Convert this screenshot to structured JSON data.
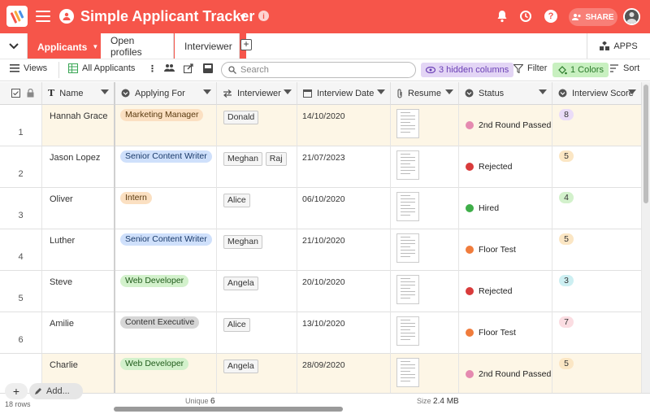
{
  "header": {
    "title": "Simple Applicant Tracker",
    "share_label": "SHARE"
  },
  "tabs": [
    {
      "label": "Applicants",
      "active": true
    },
    {
      "label": "Open profiles",
      "active": false
    },
    {
      "label": "Interviewer",
      "active": false
    }
  ],
  "apps_label": "APPS",
  "toolbar": {
    "views_label": "Views",
    "view_name": "All Applicants",
    "search_placeholder": "Search",
    "hidden_columns_label": "3 hidden columns",
    "filter_label": "Filter",
    "colors_label": "1 Colors",
    "sort_label": "Sort"
  },
  "columns": [
    "Name",
    "Applying For",
    "Interviewer",
    "Interview Date",
    "Resume",
    "Status",
    "Interview Score"
  ],
  "rows": [
    {
      "num": "1",
      "name": "Hannah Grace",
      "applying_for": "Marketing Manager",
      "applying_color": "orange",
      "interviewers": [
        "Donald"
      ],
      "date": "14/10/2020",
      "status": "2nd Round Passed",
      "status_color": "#e58ab0",
      "score": "8",
      "score_bg": "#eadcf8",
      "highlight": true
    },
    {
      "num": "2",
      "name": "Jason Lopez",
      "applying_for": "Senior Content Writer",
      "applying_color": "blue",
      "interviewers": [
        "Meghan",
        "Raj"
      ],
      "date": "21/07/2023",
      "status": "Rejected",
      "status_color": "#d93b3b",
      "score": "5",
      "score_bg": "#fbe6c4",
      "highlight": false
    },
    {
      "num": "3",
      "name": "Oliver",
      "applying_for": "Intern",
      "applying_color": "orange",
      "interviewers": [
        "Alice"
      ],
      "date": "06/10/2020",
      "status": "Hired",
      "status_color": "#3fae49",
      "score": "4",
      "score_bg": "#d3f1cc",
      "highlight": false
    },
    {
      "num": "4",
      "name": "Luther",
      "applying_for": "Senior Content Writer",
      "applying_color": "blue",
      "interviewers": [
        "Meghan"
      ],
      "date": "21/10/2020",
      "status": "Floor Test",
      "status_color": "#f07c3c",
      "score": "5",
      "score_bg": "#fbe6c4",
      "highlight": false
    },
    {
      "num": "5",
      "name": "Steve",
      "applying_for": "Web Developer",
      "applying_color": "green",
      "interviewers": [
        "Angela"
      ],
      "date": "20/10/2020",
      "status": "Rejected",
      "status_color": "#d93b3b",
      "score": "3",
      "score_bg": "#cdeff2",
      "highlight": false
    },
    {
      "num": "6",
      "name": "Amilie",
      "applying_for": "Content Executive",
      "applying_color": "gray",
      "interviewers": [
        "Alice"
      ],
      "date": "13/10/2020",
      "status": "Floor Test",
      "status_color": "#f07c3c",
      "score": "7",
      "score_bg": "#fbdde2",
      "highlight": false
    },
    {
      "num": "",
      "name": "Charlie",
      "applying_for": "Web Developer",
      "applying_color": "green",
      "interviewers": [
        "Angela"
      ],
      "date": "28/09/2020",
      "status": "2nd Round Passed",
      "status_color": "#e58ab0",
      "score": "5",
      "score_bg": "#fbe6c4",
      "highlight": true
    }
  ],
  "footer": {
    "add_label": "Add...",
    "rows_count": "18 rows",
    "unique_label": "Unique",
    "unique_value": "6",
    "size_label": "Size",
    "size_value": "2.4 MB"
  }
}
